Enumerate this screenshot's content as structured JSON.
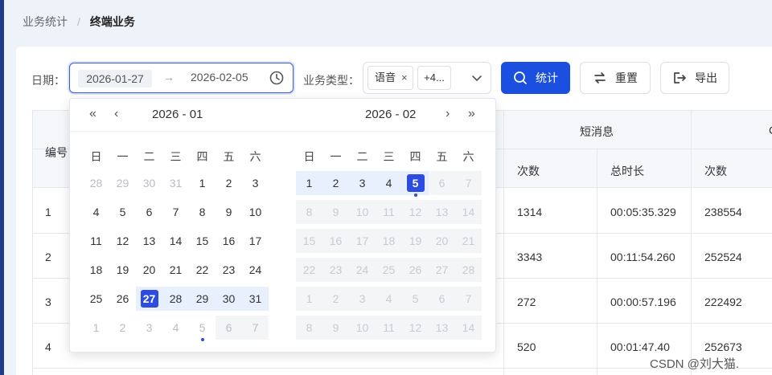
{
  "breadcrumb": {
    "first": "业务统计",
    "sep": "/",
    "current": "终端业务"
  },
  "filters": {
    "date_label": "日期：",
    "date_start": "2026-01-27",
    "date_arrow": "→",
    "date_end": "2026-02-05",
    "type_label": "业务类型：",
    "type_tag": "语音",
    "type_tag_close": "×",
    "type_more": "+4..."
  },
  "buttons": {
    "stat": "统计",
    "reset": "重置",
    "export": "导出"
  },
  "table": {
    "col_id": "编号",
    "group_sms": "短消息",
    "group_next_partial": "C",
    "sub_count": "次数",
    "sub_duration": "总时长",
    "sub_count2": "次数",
    "rows": [
      {
        "id": "1",
        "count": "1314",
        "duration": "00:05:35.329",
        "count2": "238554"
      },
      {
        "id": "2",
        "count": "3343",
        "duration": "00:11:54.260",
        "count2": "252524"
      },
      {
        "id": "3",
        "count": "272",
        "duration": "00:00:57.196",
        "count2": "222492"
      },
      {
        "id": "4",
        "count": "520",
        "duration": "00:01:47.40",
        "count2": "252673"
      }
    ]
  },
  "picker": {
    "nav_prev_year": "«",
    "nav_prev_month": "‹",
    "nav_next_month": "›",
    "nav_next_year": "»",
    "left_title": "2026 - 01",
    "right_title": "2026 - 02",
    "weekdays": [
      "日",
      "一",
      "二",
      "三",
      "四",
      "五",
      "六"
    ],
    "left_days": [
      [
        "28",
        "29",
        "30",
        "31",
        "1",
        "2",
        "3"
      ],
      [
        "4",
        "5",
        "6",
        "7",
        "8",
        "9",
        "10"
      ],
      [
        "11",
        "12",
        "13",
        "14",
        "15",
        "16",
        "17"
      ],
      [
        "18",
        "19",
        "20",
        "21",
        "22",
        "23",
        "24"
      ],
      [
        "25",
        "26",
        "27",
        "28",
        "29",
        "30",
        "31"
      ],
      [
        "1",
        "2",
        "3",
        "4",
        "5",
        "6",
        "7"
      ]
    ],
    "right_days": [
      [
        "1",
        "2",
        "3",
        "4",
        "5",
        "6",
        "7"
      ],
      [
        "8",
        "9",
        "10",
        "11",
        "12",
        "13",
        "14"
      ],
      [
        "15",
        "16",
        "17",
        "18",
        "19",
        "20",
        "21"
      ],
      [
        "22",
        "23",
        "24",
        "25",
        "26",
        "27",
        "28"
      ],
      [
        "1",
        "2",
        "3",
        "4",
        "5",
        "6",
        "7"
      ],
      [
        "8",
        "9",
        "10",
        "11",
        "12",
        "13",
        "14"
      ]
    ],
    "accent_color": "#2e4be0",
    "range_color": "#e8f0fe"
  },
  "icons": {
    "clock": "clock-icon",
    "search": "search-icon",
    "reset": "refresh-icon",
    "export": "export-icon",
    "dropdown": "chevron-down-icon"
  },
  "watermark": "CSDN @刘大猫."
}
